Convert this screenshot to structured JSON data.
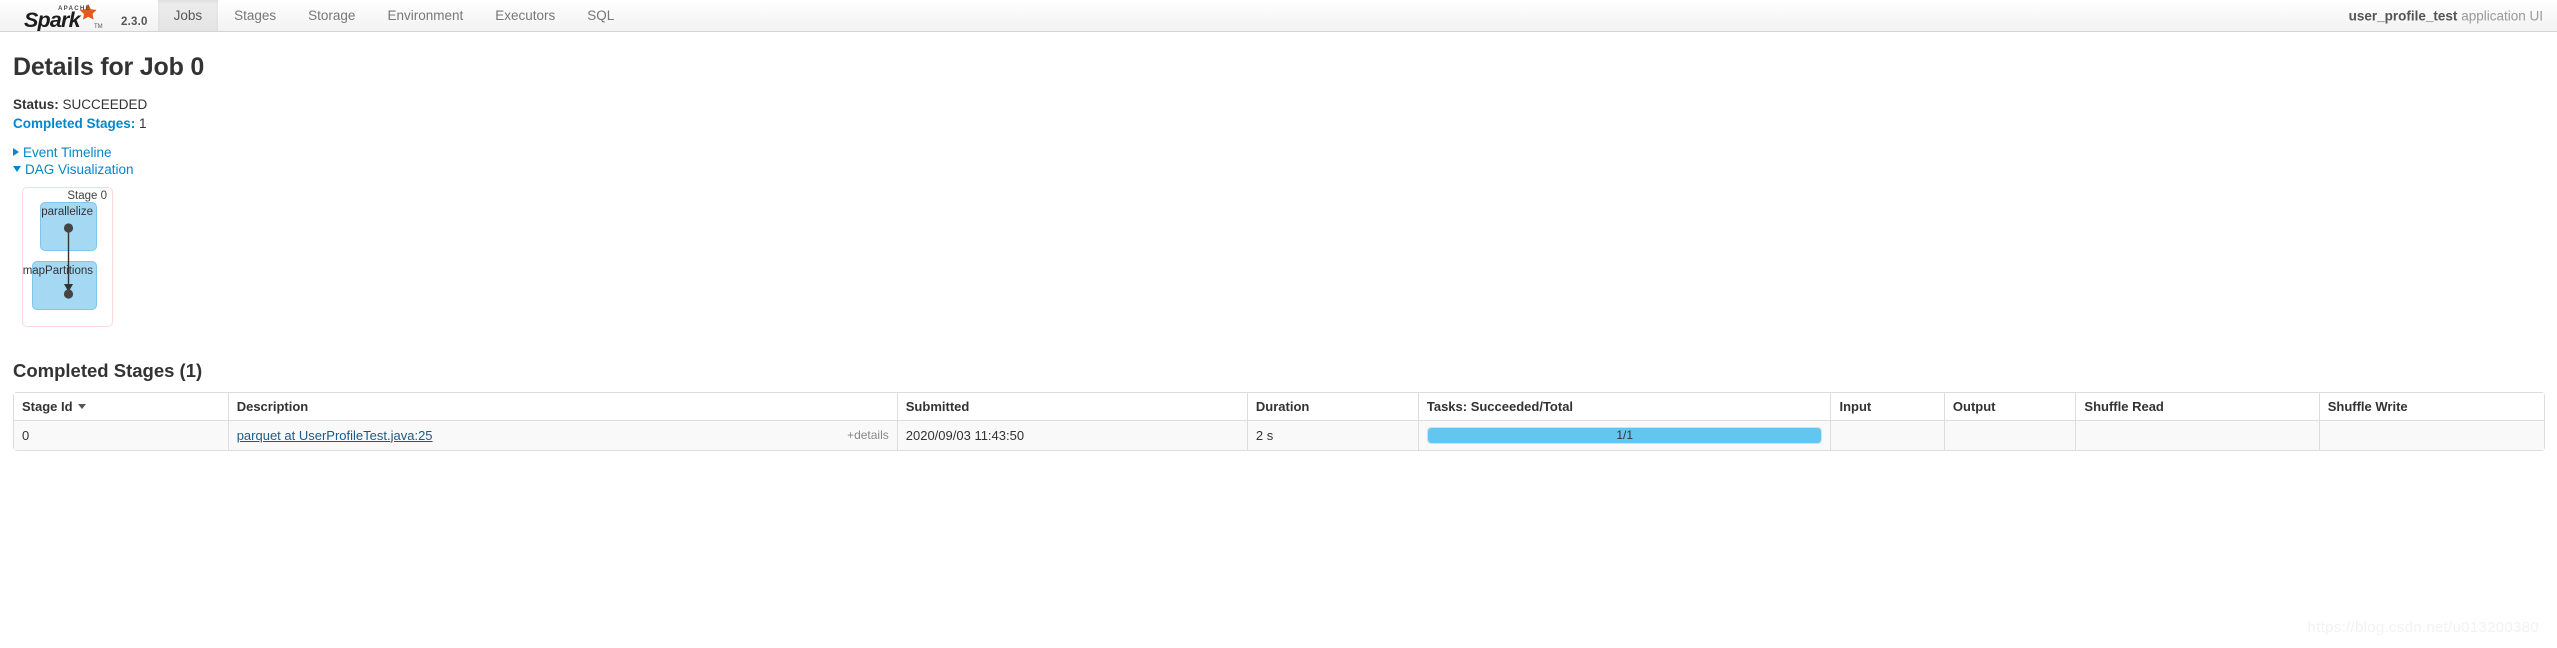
{
  "navbar": {
    "brand_name": "Apache Spark",
    "version": "2.3.0",
    "tabs": [
      {
        "label": "Jobs",
        "active": true
      },
      {
        "label": "Stages",
        "active": false
      },
      {
        "label": "Storage",
        "active": false
      },
      {
        "label": "Environment",
        "active": false
      },
      {
        "label": "Executors",
        "active": false
      },
      {
        "label": "SQL",
        "active": false
      }
    ],
    "app_name": "user_profile_test",
    "app_suffix": " application UI"
  },
  "page": {
    "title": "Details for Job 0",
    "status_label": "Status:",
    "status_value": " SUCCEEDED",
    "completed_stages_label": "Completed Stages:",
    "completed_stages_value": " 1",
    "event_timeline_label": "Event Timeline",
    "dag_visualization_label": "DAG Visualization"
  },
  "dag": {
    "stage_label": "Stage 0",
    "nodes": [
      {
        "id": "parallelize",
        "label": "parallelize"
      },
      {
        "id": "mapPartitions",
        "label": "mapPartitions"
      }
    ]
  },
  "stages_section": {
    "title": "Completed Stages (1)",
    "columns": [
      "Stage Id",
      "Description",
      "Submitted",
      "Duration",
      "Tasks: Succeeded/Total",
      "Input",
      "Output",
      "Shuffle Read",
      "Shuffle Write"
    ],
    "rows": [
      {
        "stage_id": "0",
        "description": "parquet at UserProfileTest.java:25",
        "details_label": "+details",
        "submitted": "2020/09/03 11:43:50",
        "duration": "2 s",
        "tasks_text": "1/1",
        "tasks_percent": 100,
        "input": "",
        "output": "",
        "shuffle_read": "",
        "shuffle_write": ""
      }
    ]
  },
  "watermark": {
    "text": "https://blog.csdn.net/u013200380"
  },
  "colors": {
    "link": "#0088cc",
    "progress_fill": "#63c6ee",
    "rdd_fill": "#a5d8f3",
    "rdd_border": "#7ec6ea",
    "stage_border": "#fadadd"
  }
}
